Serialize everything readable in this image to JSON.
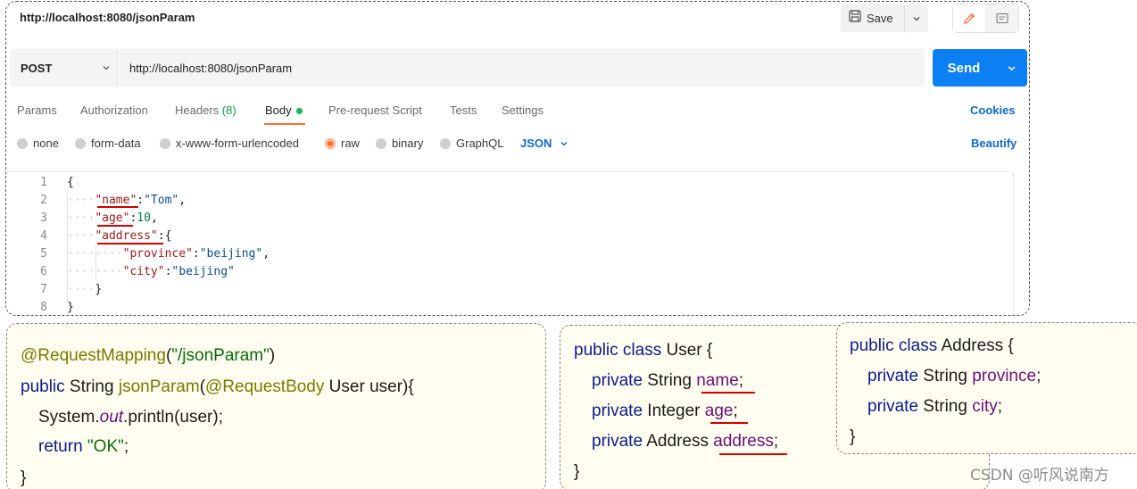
{
  "request": {
    "title": "http://localhost:8080/jsonParam",
    "save_label": "Save",
    "method": "POST",
    "url": "http://localhost:8080/jsonParam",
    "send_label": "Send"
  },
  "tabs": {
    "params": "Params",
    "authorization": "Authorization",
    "headers": "Headers",
    "headers_count": "(8)",
    "body": "Body",
    "prerequest": "Pre-request Script",
    "tests": "Tests",
    "settings": "Settings",
    "cookies": "Cookies"
  },
  "body_types": {
    "none": "none",
    "form_data": "form-data",
    "urlencoded": "x-www-form-urlencoded",
    "raw": "raw",
    "binary": "binary",
    "graphql": "GraphQL",
    "format": "JSON",
    "beautify": "Beautify"
  },
  "editor": {
    "lines": [
      {
        "n": "1",
        "tokens": [
          [
            "p",
            "{"
          ]
        ]
      },
      {
        "n": "2",
        "tokens": [
          [
            "w",
            "····"
          ],
          [
            "k",
            "\"name\""
          ],
          [
            "p",
            ":"
          ],
          [
            "s",
            "\"Tom\""
          ],
          [
            "p",
            ","
          ]
        ]
      },
      {
        "n": "3",
        "tokens": [
          [
            "w",
            "····"
          ],
          [
            "k",
            "\"age\""
          ],
          [
            "p",
            ":"
          ],
          [
            "n",
            "10"
          ],
          [
            "p",
            ","
          ]
        ]
      },
      {
        "n": "4",
        "tokens": [
          [
            "w",
            "····"
          ],
          [
            "k",
            "\"address\""
          ],
          [
            "p",
            ":{"
          ]
        ]
      },
      {
        "n": "5",
        "tokens": [
          [
            "w",
            "········"
          ],
          [
            "k",
            "\"province\""
          ],
          [
            "p",
            ":"
          ],
          [
            "s",
            "\"beijing\""
          ],
          [
            "p",
            ","
          ]
        ]
      },
      {
        "n": "6",
        "tokens": [
          [
            "w",
            "········"
          ],
          [
            "k",
            "\"city\""
          ],
          [
            "p",
            ":"
          ],
          [
            "s",
            "\"beijing\""
          ]
        ]
      },
      {
        "n": "7",
        "tokens": [
          [
            "w",
            "····"
          ],
          [
            "p",
            "}"
          ]
        ]
      },
      {
        "n": "8",
        "tokens": [
          [
            "p",
            "}"
          ]
        ]
      }
    ]
  },
  "controller_code": {
    "line1_ann": "@RequestMapping",
    "line1_open": "(",
    "line1_str": "\"/jsonParam\"",
    "line1_close": ")",
    "line2_kw": "public",
    "line2_type": " String ",
    "line2_method": "jsonParam",
    "line2_open": "(",
    "line2_ann": "@RequestBody",
    "line2_rest": " User user){",
    "line3_a": "System.",
    "line3_out": "out",
    "line3_b": ".println(user);",
    "line4_kw": "return ",
    "line4_str": "\"OK\"",
    "line4_end": ";",
    "line5": "}"
  },
  "user_class": {
    "decl_kw": "public class",
    "decl_rest": " User {",
    "f1_kw": "private",
    "f1_type": " String ",
    "f1_name": "name",
    "f2_kw": "private",
    "f2_type": " Integer ",
    "f2_name": "age",
    "f3_kw": "private",
    "f3_type": " Address ",
    "f3_name": "address",
    "semi": ";",
    "close": "}"
  },
  "address_class": {
    "decl_kw": "public class",
    "decl_rest": " Address {",
    "f1_kw": "private",
    "f1_type": " String ",
    "f1_name": "province",
    "f2_kw": "private",
    "f2_type": " String ",
    "f2_name": "city",
    "semi": ";",
    "close": "}"
  },
  "watermark": "CSDN @听风说南方",
  "colors": {
    "send": "#0c7ff2",
    "active_tab": "#ff6c37",
    "link": "#0b6bcb",
    "highlight": "#d40000",
    "panel_bg": "#fffef0"
  }
}
